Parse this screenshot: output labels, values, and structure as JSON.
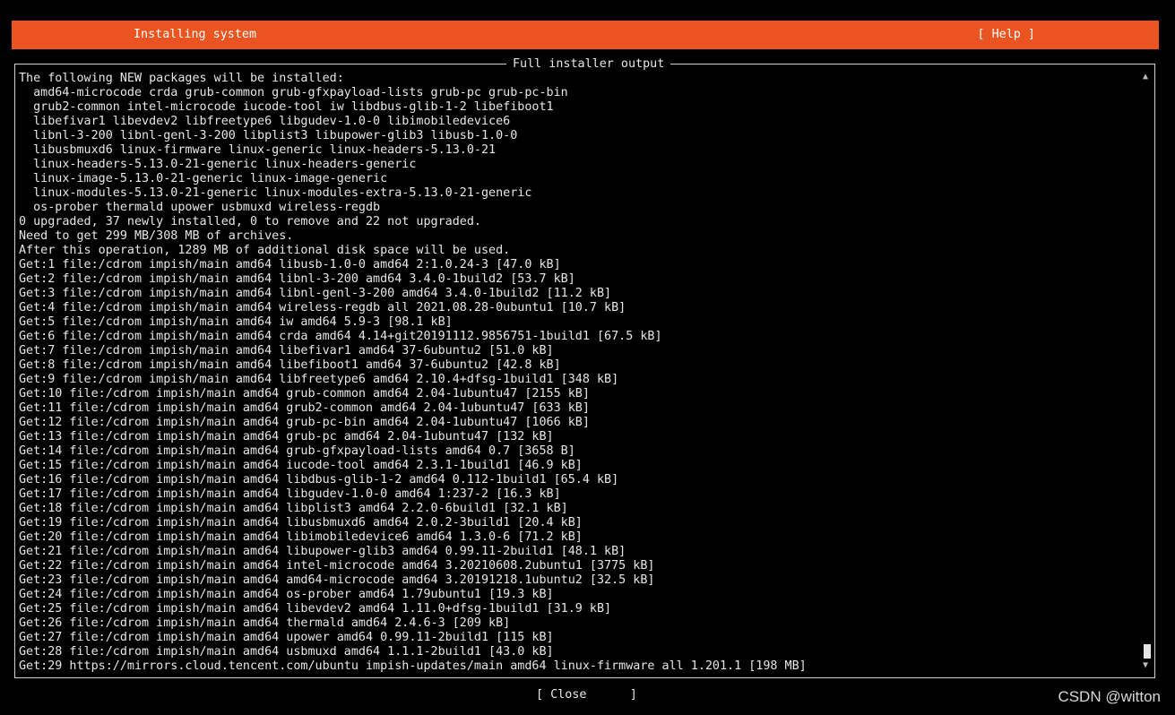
{
  "header": {
    "title": "Installing system",
    "help_label": "[ Help ]"
  },
  "panel": {
    "title": "Full installer output",
    "lines": [
      "The following NEW packages will be installed:",
      "  amd64-microcode crda grub-common grub-gfxpayload-lists grub-pc grub-pc-bin",
      "  grub2-common intel-microcode iucode-tool iw libdbus-glib-1-2 libefiboot1",
      "  libefivar1 libevdev2 libfreetype6 libgudev-1.0-0 libimobiledevice6",
      "  libnl-3-200 libnl-genl-3-200 libplist3 libupower-glib3 libusb-1.0-0",
      "  libusbmuxd6 linux-firmware linux-generic linux-headers-5.13.0-21",
      "  linux-headers-5.13.0-21-generic linux-headers-generic",
      "  linux-image-5.13.0-21-generic linux-image-generic",
      "  linux-modules-5.13.0-21-generic linux-modules-extra-5.13.0-21-generic",
      "  os-prober thermald upower usbmuxd wireless-regdb",
      "0 upgraded, 37 newly installed, 0 to remove and 22 not upgraded.",
      "Need to get 299 MB/308 MB of archives.",
      "After this operation, 1289 MB of additional disk space will be used.",
      "Get:1 file:/cdrom impish/main amd64 libusb-1.0-0 amd64 2:1.0.24-3 [47.0 kB]",
      "Get:2 file:/cdrom impish/main amd64 libnl-3-200 amd64 3.4.0-1build2 [53.7 kB]",
      "Get:3 file:/cdrom impish/main amd64 libnl-genl-3-200 amd64 3.4.0-1build2 [11.2 kB]",
      "Get:4 file:/cdrom impish/main amd64 wireless-regdb all 2021.08.28-0ubuntu1 [10.7 kB]",
      "Get:5 file:/cdrom impish/main amd64 iw amd64 5.9-3 [98.1 kB]",
      "Get:6 file:/cdrom impish/main amd64 crda amd64 4.14+git20191112.9856751-1build1 [67.5 kB]",
      "Get:7 file:/cdrom impish/main amd64 libefivar1 amd64 37-6ubuntu2 [51.0 kB]",
      "Get:8 file:/cdrom impish/main amd64 libefiboot1 amd64 37-6ubuntu2 [42.8 kB]",
      "Get:9 file:/cdrom impish/main amd64 libfreetype6 amd64 2.10.4+dfsg-1build1 [348 kB]",
      "Get:10 file:/cdrom impish/main amd64 grub-common amd64 2.04-1ubuntu47 [2155 kB]",
      "Get:11 file:/cdrom impish/main amd64 grub2-common amd64 2.04-1ubuntu47 [633 kB]",
      "Get:12 file:/cdrom impish/main amd64 grub-pc-bin amd64 2.04-1ubuntu47 [1066 kB]",
      "Get:13 file:/cdrom impish/main amd64 grub-pc amd64 2.04-1ubuntu47 [132 kB]",
      "Get:14 file:/cdrom impish/main amd64 grub-gfxpayload-lists amd64 0.7 [3658 B]",
      "Get:15 file:/cdrom impish/main amd64 iucode-tool amd64 2.3.1-1build1 [46.9 kB]",
      "Get:16 file:/cdrom impish/main amd64 libdbus-glib-1-2 amd64 0.112-1build1 [65.4 kB]",
      "Get:17 file:/cdrom impish/main amd64 libgudev-1.0-0 amd64 1:237-2 [16.3 kB]",
      "Get:18 file:/cdrom impish/main amd64 libplist3 amd64 2.2.0-6build1 [32.1 kB]",
      "Get:19 file:/cdrom impish/main amd64 libusbmuxd6 amd64 2.0.2-3build1 [20.4 kB]",
      "Get:20 file:/cdrom impish/main amd64 libimobiledevice6 amd64 1.3.0-6 [71.2 kB]",
      "Get:21 file:/cdrom impish/main amd64 libupower-glib3 amd64 0.99.11-2build1 [48.1 kB]",
      "Get:22 file:/cdrom impish/main amd64 intel-microcode amd64 3.20210608.2ubuntu1 [3775 kB]",
      "Get:23 file:/cdrom impish/main amd64 amd64-microcode amd64 3.20191218.1ubuntu2 [32.5 kB]",
      "Get:24 file:/cdrom impish/main amd64 os-prober amd64 1.79ubuntu1 [19.3 kB]",
      "Get:25 file:/cdrom impish/main amd64 libevdev2 amd64 1.11.0+dfsg-1build1 [31.9 kB]",
      "Get:26 file:/cdrom impish/main amd64 thermald amd64 2.4.6-3 [209 kB]",
      "Get:27 file:/cdrom impish/main amd64 upower amd64 0.99.11-2build1 [115 kB]",
      "Get:28 file:/cdrom impish/main amd64 usbmuxd amd64 1.1.1-2build1 [43.0 kB]",
      "Get:29 https://mirrors.cloud.tencent.com/ubuntu impish-updates/main amd64 linux-firmware all 1.201.1 [198 MB]"
    ]
  },
  "close_label": "[ Close      ]",
  "watermark": "CSDN @witton",
  "icons": {
    "scroll_up": "scroll-up-arrow-icon",
    "scroll_down": "scroll-down-arrow-icon"
  },
  "colors": {
    "accent": "#e95420",
    "background": "#000000",
    "text": "#e6e6e6"
  }
}
